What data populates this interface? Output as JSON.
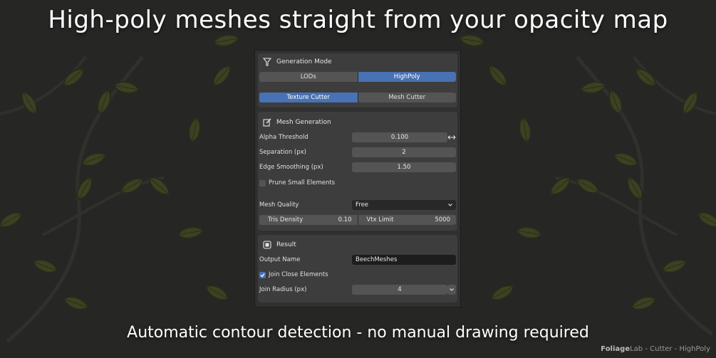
{
  "headline": "High-poly meshes straight from your opacity map",
  "subline": "Automatic contour detection - no manual drawing required",
  "brand": {
    "bold": "Foliage",
    "rest": "Lab - Cutter - HighPoly"
  },
  "colors": {
    "accent": "#4772b3",
    "panel": "#303030",
    "section": "#3d3d3d",
    "field": "#545454",
    "leaf": "#4d5a1f"
  },
  "generation": {
    "title": "Generation Mode",
    "icon": "filter-funnel-icon",
    "mode": [
      "LODs",
      "HighPoly"
    ],
    "mode_active": 1,
    "cutter": [
      "Texture Cutter",
      "Mesh Cutter"
    ],
    "cutter_active": 0
  },
  "mesh": {
    "title": "Mesh Generation",
    "icon": "edit-mesh-icon",
    "alpha_label": "Alpha Threshold",
    "alpha_value": "0.100",
    "separation_label": "Separation (px)",
    "separation_value": "2",
    "smoothing_label": "Edge Smoothing (px)",
    "smoothing_value": "1.50",
    "prune_label": "Prune Small Elements",
    "prune_checked": false,
    "quality_label": "Mesh Quality",
    "quality_value": "Free",
    "tris_label": "Tris Density",
    "tris_value": "0.10",
    "vtx_label": "Vtx Limit",
    "vtx_value": "5000"
  },
  "result": {
    "title": "Result",
    "icon": "result-square-icon",
    "output_label": "Output Name",
    "output_value": "BeechMeshes",
    "join_label": "Join Close Elements",
    "join_checked": true,
    "radius_label": "Join Radius (px)",
    "radius_value": "4"
  }
}
